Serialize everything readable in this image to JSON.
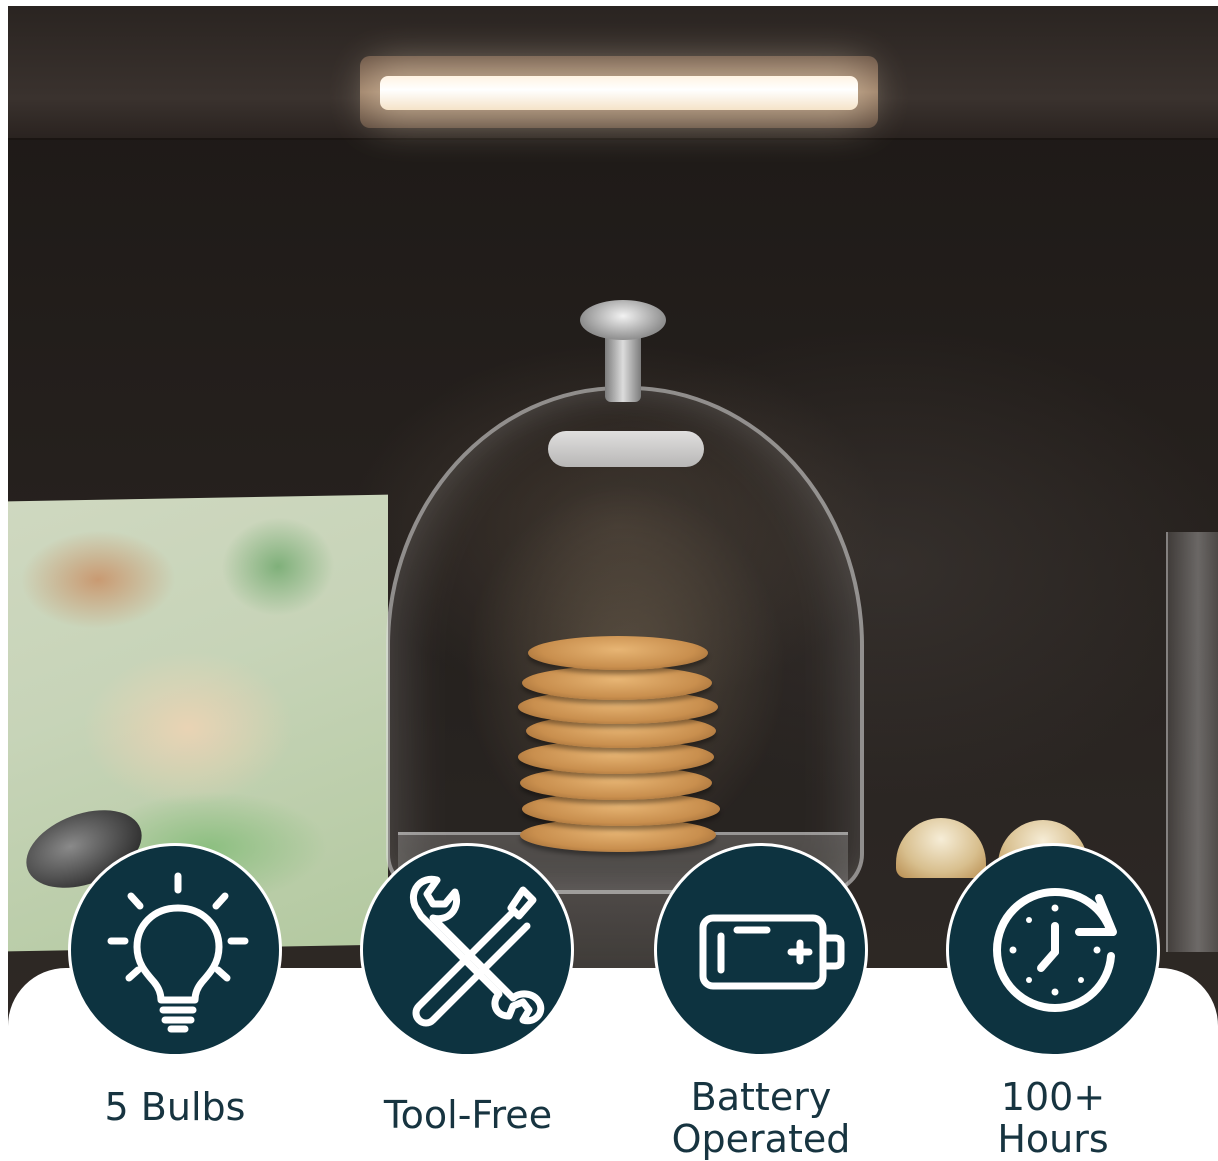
{
  "features": [
    {
      "icon": "light-bulb-icon",
      "label": "5 Bulbs"
    },
    {
      "icon": "tools-icon",
      "label": "Tool-Free"
    },
    {
      "icon": "battery-icon",
      "label": "Battery\nOperated"
    },
    {
      "icon": "clock-refresh-icon",
      "label": "100+\nHours"
    }
  ],
  "colors": {
    "badge_background": "#0d3340",
    "label_text": "#173440",
    "panel_background": "#ffffff"
  }
}
